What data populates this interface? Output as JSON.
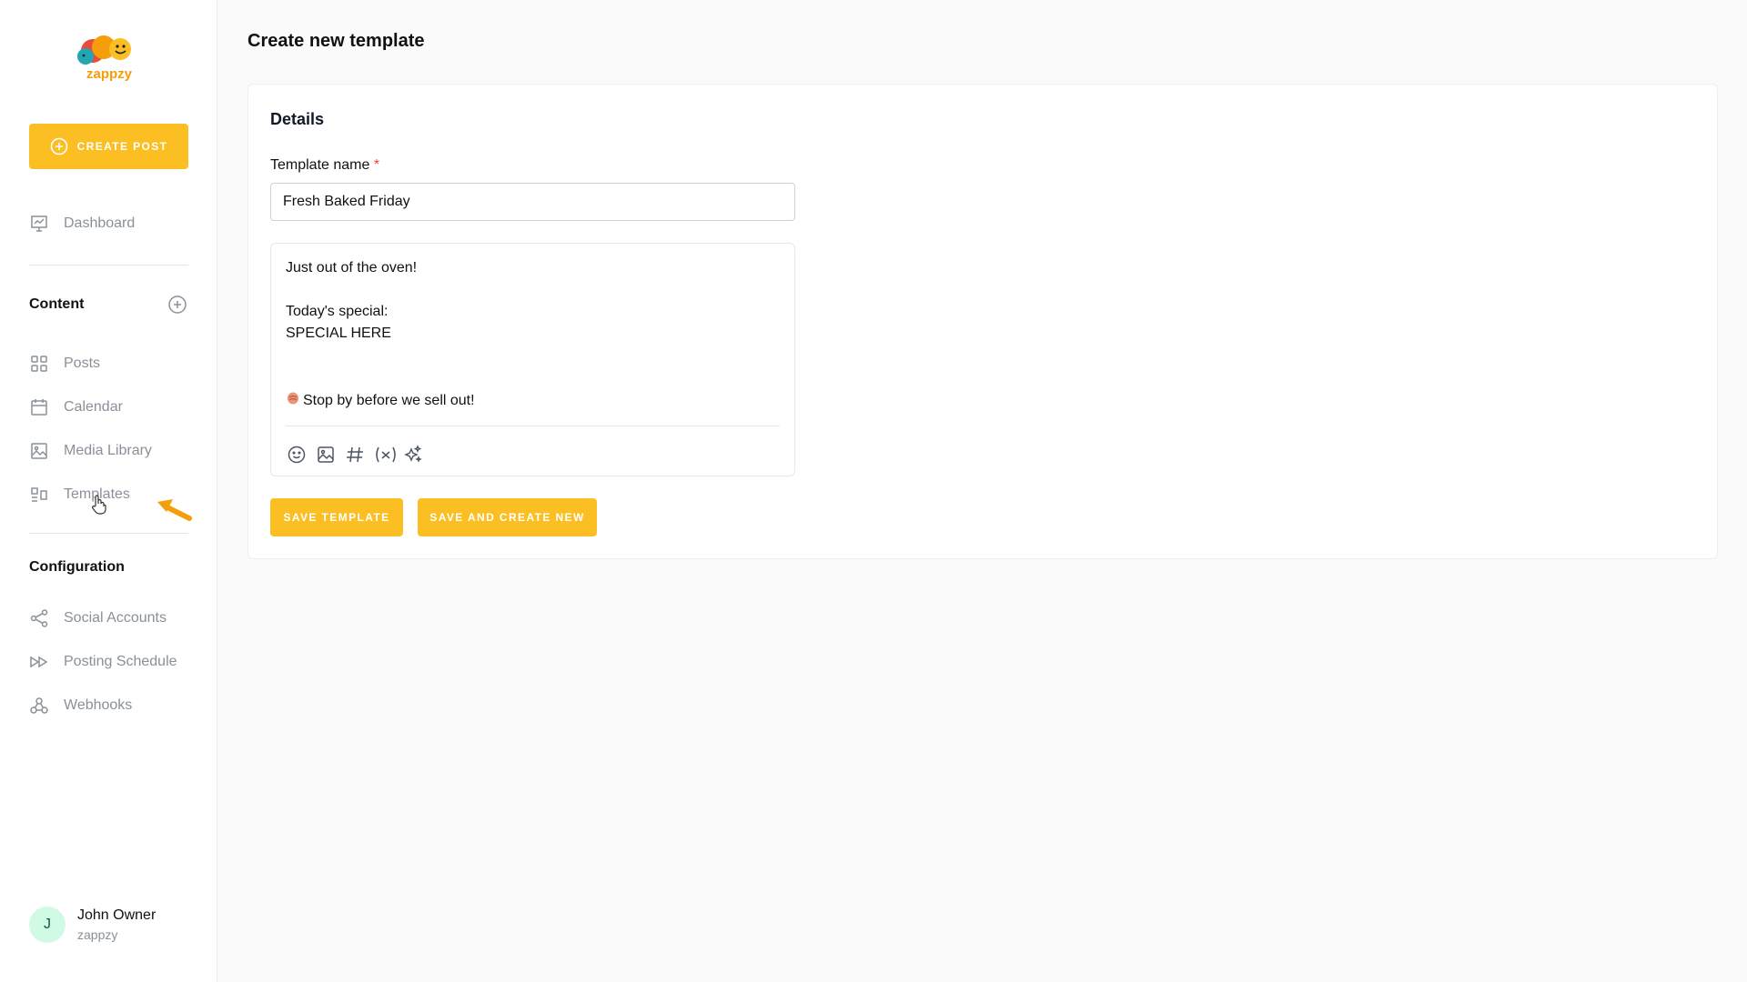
{
  "brand": {
    "name": "zappzy",
    "accent": "#fbbf24"
  },
  "sidebar": {
    "create_post_label": "CREATE POST",
    "dashboard_label": "Dashboard",
    "content_section": "Content",
    "content_items": [
      {
        "label": "Posts",
        "icon": "grid-icon"
      },
      {
        "label": "Calendar",
        "icon": "calendar-icon"
      },
      {
        "label": "Media Library",
        "icon": "image-icon"
      },
      {
        "label": "Templates",
        "icon": "templates-icon"
      }
    ],
    "config_section": "Configuration",
    "config_items": [
      {
        "label": "Social Accounts",
        "icon": "share-icon"
      },
      {
        "label": "Posting Schedule",
        "icon": "fast-forward-icon"
      },
      {
        "label": "Webhooks",
        "icon": "webhook-icon"
      }
    ],
    "user": {
      "initial": "J",
      "name": "John Owner",
      "org": "zappzy"
    }
  },
  "main": {
    "title": "Create new template",
    "card_title": "Details",
    "template_name_label": "Template name",
    "required_mark": "*",
    "template_name_value": "Fresh Baked Friday",
    "body_lines": {
      "line1": "Just out of the oven!",
      "line2": "Today's special:",
      "line3": "SPECIAL HERE",
      "line4": "Stop by before we sell out!"
    },
    "toolbar": [
      "emoji-icon",
      "image-icon",
      "hashtag-icon",
      "variable-icon",
      "ai-sparkle-icon"
    ],
    "save_label": "SAVE TEMPLATE",
    "save_new_label": "SAVE AND CREATE NEW"
  }
}
